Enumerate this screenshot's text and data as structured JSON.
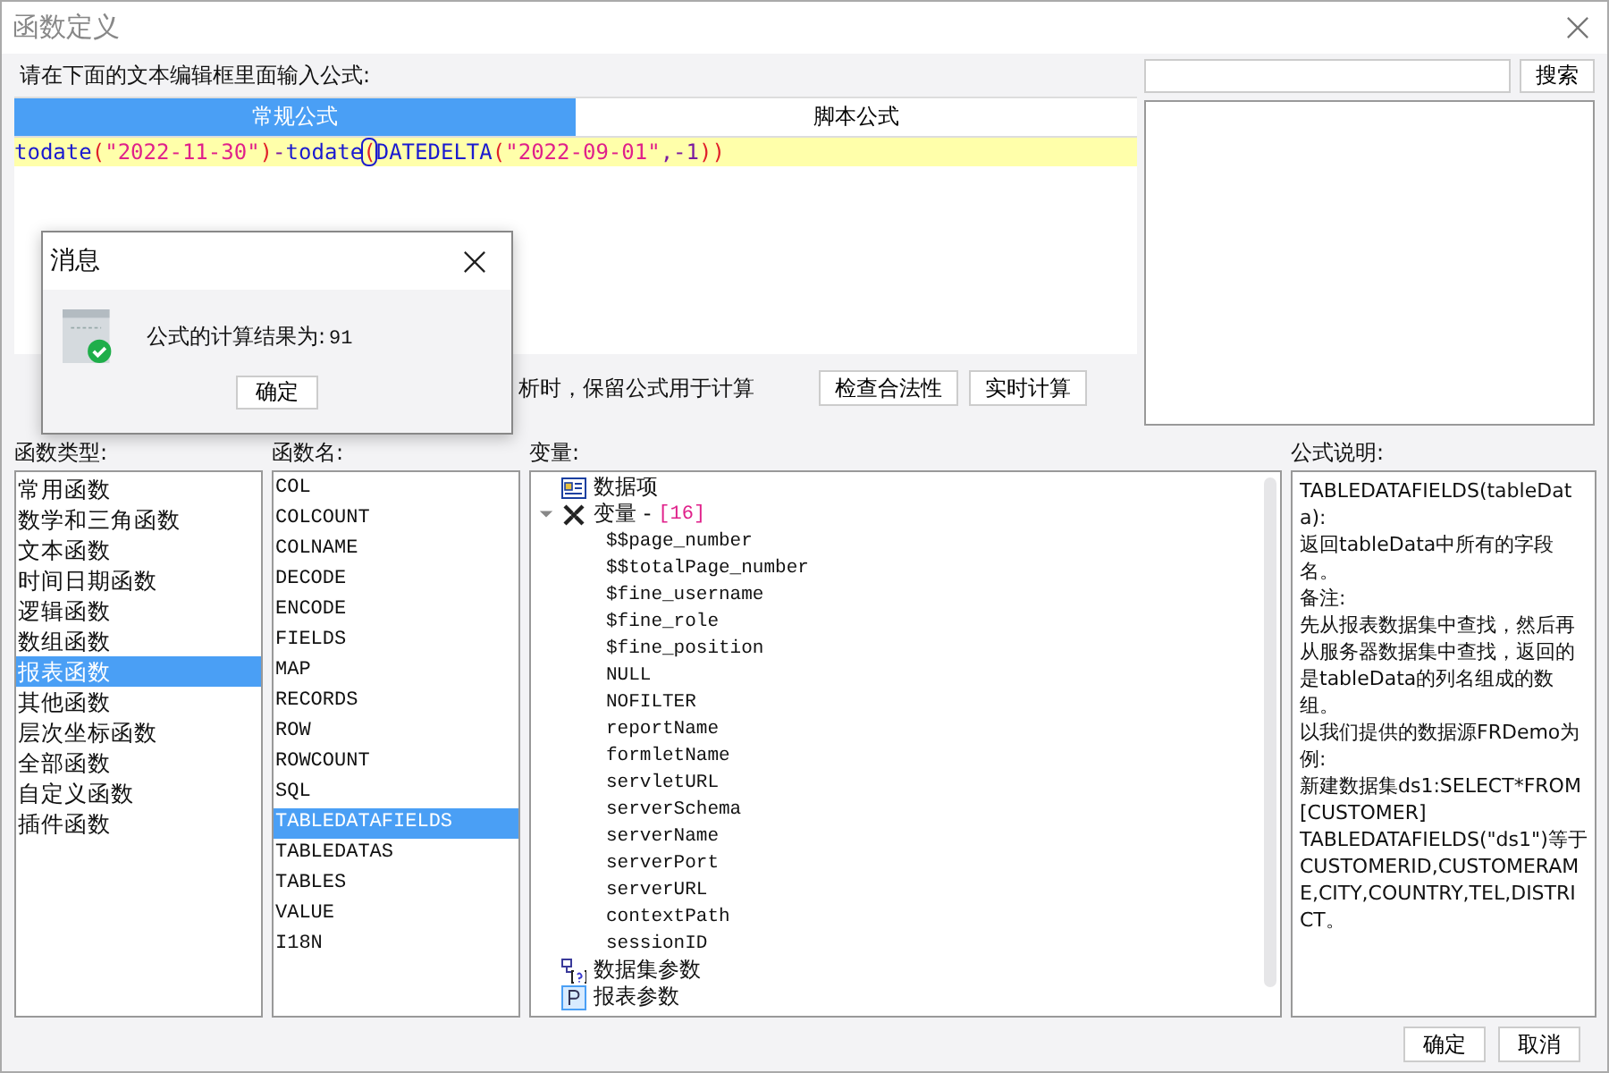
{
  "window": {
    "title": "函数定义"
  },
  "prompt": "请在下面的文本编辑框里面输入公式:",
  "tabs": [
    {
      "label": "常规公式",
      "selected": true
    },
    {
      "label": "脚本公式",
      "selected": false
    }
  ],
  "formula": [
    {
      "kind": "func",
      "text": "todate"
    },
    {
      "kind": "paren",
      "text": "("
    },
    {
      "kind": "string",
      "text": "\"2022-11-30\""
    },
    {
      "kind": "paren",
      "text": ")"
    },
    {
      "kind": "op",
      "text": "-"
    },
    {
      "kind": "func",
      "text": "todate"
    },
    {
      "kind": "paren",
      "text": "(",
      "cursor": true
    },
    {
      "kind": "func",
      "text": "DATEDELTA"
    },
    {
      "kind": "paren",
      "text": "("
    },
    {
      "kind": "string",
      "text": "\"2022-09-01\""
    },
    {
      "kind": "op",
      "text": ",-1"
    },
    {
      "kind": "paren",
      "text": "))"
    }
  ],
  "keep_formula_text": "析时，保留公式用于计算",
  "actions": [
    "检查合法性",
    "实时计算"
  ],
  "search": {
    "button": "搜索"
  },
  "function_types": {
    "label": "函数类型:",
    "items": [
      {
        "label": "常用函数",
        "selected": false
      },
      {
        "label": "数学和三角函数",
        "selected": false
      },
      {
        "label": "文本函数",
        "selected": false
      },
      {
        "label": "时间日期函数",
        "selected": false
      },
      {
        "label": "逻辑函数",
        "selected": false
      },
      {
        "label": "数组函数",
        "selected": false
      },
      {
        "label": "报表函数",
        "selected": true
      },
      {
        "label": "其他函数",
        "selected": false
      },
      {
        "label": "层次坐标函数",
        "selected": false
      },
      {
        "label": "全部函数",
        "selected": false
      },
      {
        "label": "自定义函数",
        "selected": false
      },
      {
        "label": "插件函数",
        "selected": false
      }
    ]
  },
  "function_names": {
    "label": "函数名:",
    "items": [
      {
        "label": "COL",
        "selected": false
      },
      {
        "label": "COLCOUNT",
        "selected": false
      },
      {
        "label": "COLNAME",
        "selected": false
      },
      {
        "label": "DECODE",
        "selected": false
      },
      {
        "label": "ENCODE",
        "selected": false
      },
      {
        "label": "FIELDS",
        "selected": false
      },
      {
        "label": "MAP",
        "selected": false
      },
      {
        "label": "RECORDS",
        "selected": false
      },
      {
        "label": "ROW",
        "selected": false
      },
      {
        "label": "ROWCOUNT",
        "selected": false
      },
      {
        "label": "SQL",
        "selected": false
      },
      {
        "label": "TABLEDATAFIELDS",
        "selected": true
      },
      {
        "label": "TABLEDATAS",
        "selected": false
      },
      {
        "label": "TABLES",
        "selected": false
      },
      {
        "label": "VALUE",
        "selected": false
      },
      {
        "label": "I18N",
        "selected": false
      }
    ]
  },
  "variables": {
    "label": "变量:",
    "tree": [
      {
        "label": "数据项",
        "kind": "form"
      },
      {
        "label": "变量 -",
        "count": "[16]",
        "kind": "vars",
        "expanded": true,
        "children": [
          {
            "label": "$$page_number"
          },
          {
            "label": "$$totalPage_number"
          },
          {
            "label": "$fine_username"
          },
          {
            "label": "$fine_role"
          },
          {
            "label": "$fine_position"
          },
          {
            "label": "NULL"
          },
          {
            "label": "NOFILTER"
          },
          {
            "label": "reportName"
          },
          {
            "label": "formletName"
          },
          {
            "label": "servletURL"
          },
          {
            "label": "serverSchema"
          },
          {
            "label": "serverName"
          },
          {
            "label": "serverPort"
          },
          {
            "label": "serverURL"
          },
          {
            "label": "contextPath"
          },
          {
            "label": "sessionID"
          }
        ]
      },
      {
        "label": "数据集参数",
        "kind": "dataset"
      },
      {
        "label": "报表参数",
        "kind": "param"
      }
    ]
  },
  "description": {
    "label": "公式说明:",
    "paragraphs": [
      "TABLEDATAFIELDS(tableData):",
      "返回tableData中所有的字段名。",
      "备注:",
      "先从报表数据集中查找，然后再从服务器数据集中查找，返回的是tableData的列名组成的数组。",
      "以我们提供的数据源FRDemo为例:",
      "新建数据集ds1:SELECT*FROM[CUSTOMER]",
      "TABLEDATAFIELDS(\"ds1\")等于CUSTOMERID,CUSTOMERAME,CITY,COUNTRY,TEL,DISTRICT。"
    ]
  },
  "buttons": [
    "确定",
    "取消"
  ],
  "message": {
    "title": "消息",
    "text": "公式的计算结果为:",
    "result": "91",
    "button": "确定"
  }
}
